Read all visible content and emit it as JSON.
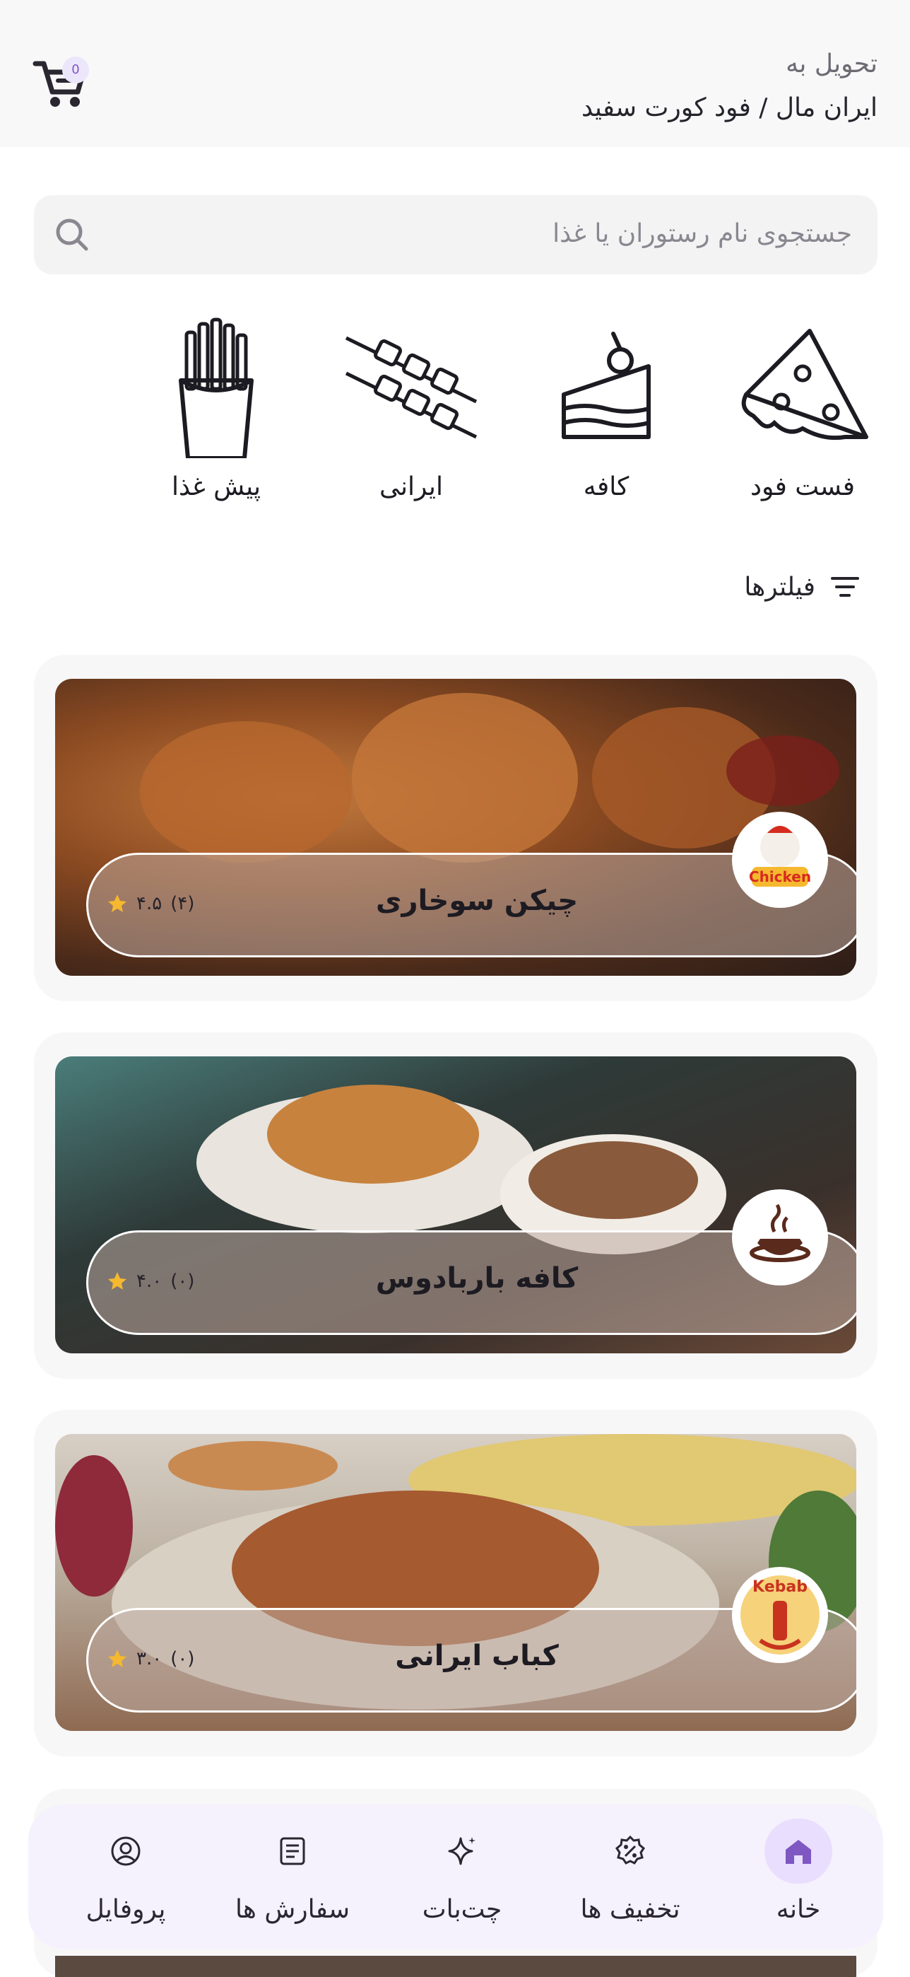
{
  "header": {
    "deliver_label": "تحویل به",
    "deliver_address": "ایران مال / فود کورت سفید",
    "cart_badge": "0",
    "cart_icon": "cart-icon"
  },
  "search": {
    "placeholder": "جستجوی نام رستوران یا غذا",
    "icon": "search-icon"
  },
  "categories": [
    {
      "label": "فست فود",
      "icon": "pizza-slice-icon"
    },
    {
      "label": "کافه",
      "icon": "cake-slice-icon"
    },
    {
      "label": "ایرانی",
      "icon": "kebab-skewer-icon"
    },
    {
      "label": "پیش غذا",
      "icon": "french-fries-icon"
    }
  ],
  "filters": {
    "label": "فیلترها",
    "icon": "filter-icon"
  },
  "restaurants": [
    {
      "name": "چیکن سوخاری",
      "rating": "۴.۵",
      "count": "(۴)",
      "logo_text": "Chicken",
      "accent": "#d62b1f"
    },
    {
      "name": "کافه باربادوس",
      "rating": "۴.۰",
      "count": "(۰)",
      "logo_text": "",
      "accent": "#5a2a1c"
    },
    {
      "name": "کباب ایرانی",
      "rating": "۳.۰",
      "count": "(۰)",
      "logo_text": "Kebab",
      "accent": "#c8331f"
    }
  ],
  "nav": [
    {
      "label": "خانه",
      "icon": "home-icon",
      "active": true
    },
    {
      "label": "تخفیف ها",
      "icon": "discount-icon",
      "active": false
    },
    {
      "label": "چت‌بات",
      "icon": "sparkle-icon",
      "active": false
    },
    {
      "label": "سفارش ها",
      "icon": "orders-icon",
      "active": false
    },
    {
      "label": "پروفایل",
      "icon": "profile-icon",
      "active": false
    }
  ],
  "colors": {
    "accent": "#7e57c2",
    "star": "#f5b82e",
    "background": "#ffffff"
  }
}
